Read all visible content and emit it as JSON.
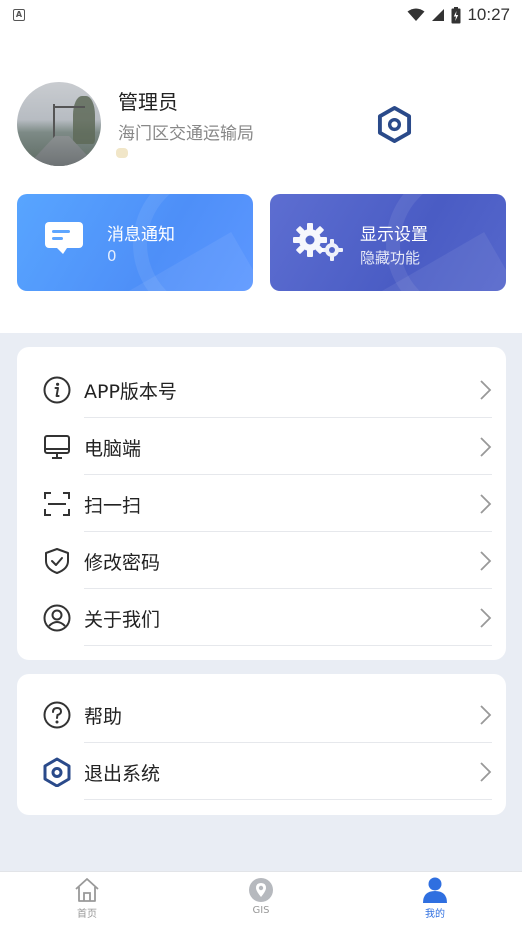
{
  "status_bar": {
    "time": "10:27",
    "notification_glyph": "A"
  },
  "profile": {
    "name": "管理员",
    "organization": "海门区交通运输局"
  },
  "cards": {
    "messages": {
      "title": "消息通知",
      "count": "0"
    },
    "display": {
      "title": "显示设置",
      "subtitle": "隐藏功能"
    }
  },
  "menu_group_1": [
    {
      "label": "APP版本号",
      "icon": "info-icon"
    },
    {
      "label": "电脑端",
      "icon": "monitor-icon"
    },
    {
      "label": "扫一扫",
      "icon": "scan-icon"
    },
    {
      "label": "修改密码",
      "icon": "shield-check-icon"
    },
    {
      "label": "关于我们",
      "icon": "user-circle-icon"
    }
  ],
  "menu_group_2": [
    {
      "label": "帮助",
      "icon": "question-icon"
    },
    {
      "label": "退出系统",
      "icon": "hexagon-logout-icon"
    }
  ],
  "bottom_nav": [
    {
      "label": "首页",
      "icon": "home-icon",
      "active": false
    },
    {
      "label": "GIS",
      "icon": "location-pin-icon",
      "active": false
    },
    {
      "label": "我的",
      "icon": "person-icon",
      "active": true
    }
  ],
  "colors": {
    "accent": "#2f6fe0",
    "card_messages": "#58a5ff",
    "card_display": "#4a5cc4",
    "hex_icon": "#2a4a8a",
    "background_gray": "#e9edf4"
  }
}
